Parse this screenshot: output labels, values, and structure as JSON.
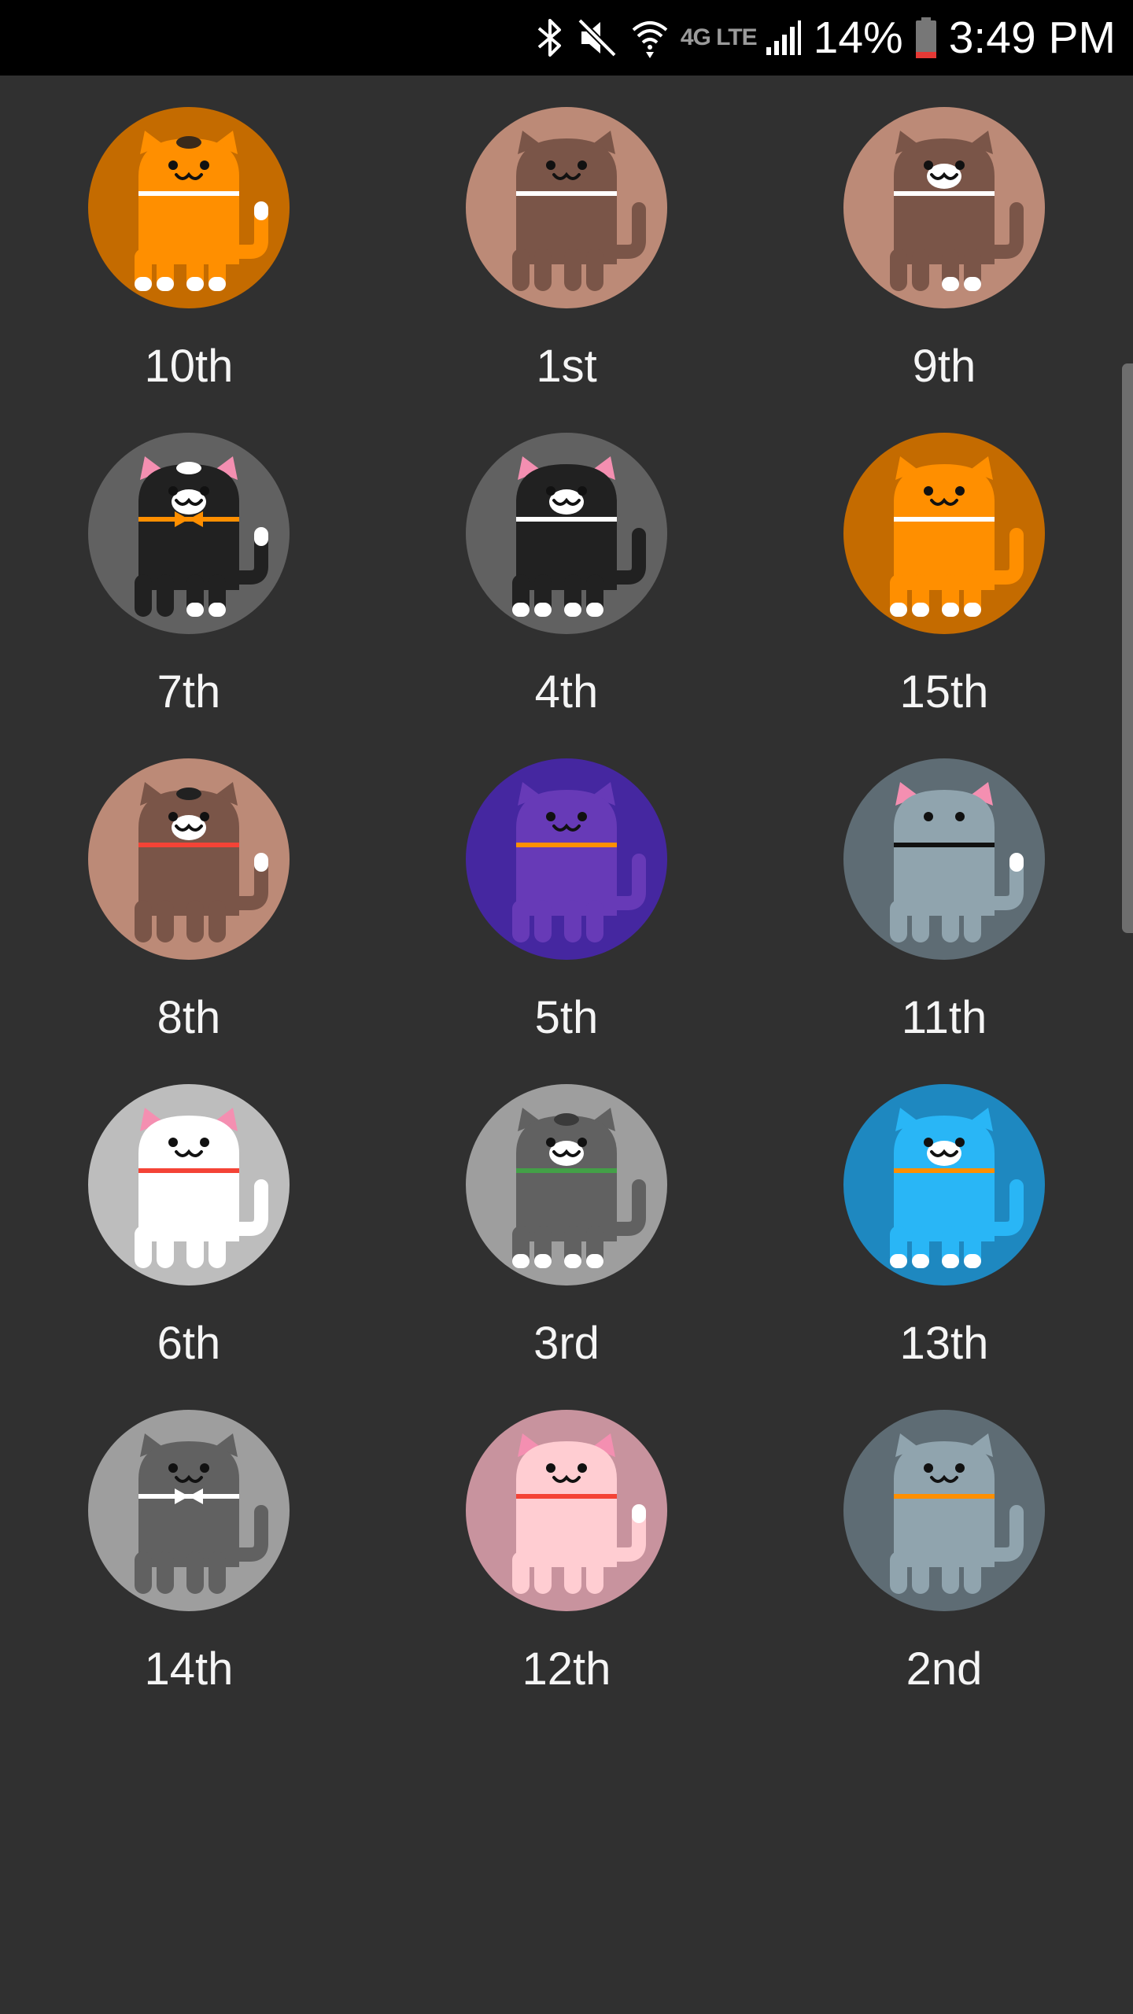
{
  "status_bar": {
    "battery_percent": "14%",
    "time": "3:49 PM",
    "network_type": "4G LTE",
    "icons": [
      "bluetooth-icon",
      "mute-icon",
      "wifi-icon",
      "lte-icon",
      "signal-icon",
      "battery-icon"
    ]
  },
  "cats": [
    {
      "label": "10th",
      "bg": "#c46b00",
      "body": "#ff8f00",
      "collar": "#ffffff",
      "ears": "#ff8f00",
      "spot": "#3a2a1a",
      "mouth": "dark",
      "white_feet": [
        1,
        1,
        1,
        1
      ],
      "white_tail": true,
      "bowtie": false
    },
    {
      "label": "1st",
      "bg": "#bc8a77",
      "body": "#7a5548",
      "collar": "#ffffff",
      "ears": "#7a5548",
      "spot": null,
      "mouth": "dark",
      "white_feet": [
        0,
        0,
        0,
        0
      ],
      "white_tail": false,
      "bowtie": false
    },
    {
      "label": "9th",
      "bg": "#bc8a77",
      "body": "#7a5548",
      "collar": "#ffffff",
      "ears": "#7a5548",
      "spot": null,
      "mouth": "white",
      "white_feet": [
        0,
        0,
        1,
        1
      ],
      "white_tail": false,
      "bowtie": false
    },
    {
      "label": "7th",
      "bg": "#616161",
      "body": "#212121",
      "collar": "#ff8f00",
      "ears": "#f48fb1",
      "spot": "#ffffff",
      "mouth": "white",
      "white_feet": [
        0,
        0,
        1,
        1
      ],
      "white_tail": true,
      "bowtie": true
    },
    {
      "label": "4th",
      "bg": "#616161",
      "body": "#212121",
      "collar": "#ffffff",
      "ears": "#f48fb1",
      "spot": null,
      "mouth": "white",
      "white_feet": [
        1,
        1,
        1,
        1
      ],
      "white_tail": false,
      "bowtie": false
    },
    {
      "label": "15th",
      "bg": "#c46b00",
      "body": "#ff8f00",
      "collar": "#ffffff",
      "ears": "#ff8f00",
      "spot": null,
      "mouth": "dark",
      "white_feet": [
        1,
        1,
        1,
        1
      ],
      "white_tail": false,
      "bowtie": false
    },
    {
      "label": "8th",
      "bg": "#bc8a77",
      "body": "#7a5548",
      "collar": "#f44336",
      "ears": "#7a5548",
      "spot": "#212121",
      "mouth": "white",
      "white_feet": [
        0,
        0,
        0,
        0
      ],
      "white_tail": true,
      "bowtie": false
    },
    {
      "label": "5th",
      "bg": "#4527a0",
      "body": "#673ab7",
      "collar": "#ff8f00",
      "ears": "#673ab7",
      "spot": null,
      "mouth": "dark",
      "white_feet": [
        0,
        0,
        0,
        0
      ],
      "white_tail": false,
      "bowtie": false
    },
    {
      "label": "11th",
      "bg": "#5e6c74",
      "body": "#90a4ae",
      "collar": "#111111",
      "ears": "#f48fb1",
      "spot": null,
      "mouth": "none",
      "white_feet": [
        0,
        0,
        0,
        0
      ],
      "white_tail": true,
      "bowtie": false
    },
    {
      "label": "6th",
      "bg": "#bdbdbd",
      "body": "#ffffff",
      "collar": "#f44336",
      "ears": "#f48fb1",
      "spot": null,
      "mouth": "dark",
      "white_feet": [
        0,
        0,
        0,
        0
      ],
      "white_tail": false,
      "bowtie": false
    },
    {
      "label": "3rd",
      "bg": "#9e9e9e",
      "body": "#616161",
      "collar": "#43a047",
      "ears": "#616161",
      "spot": "#3a3a3a",
      "mouth": "white",
      "white_feet": [
        1,
        1,
        1,
        1
      ],
      "white_tail": false,
      "bowtie": false
    },
    {
      "label": "13th",
      "bg": "#1e88c0",
      "body": "#29b6f6",
      "collar": "#ff8f00",
      "ears": "#29b6f6",
      "spot": null,
      "mouth": "white",
      "white_feet": [
        1,
        1,
        1,
        1
      ],
      "white_tail": false,
      "bowtie": false
    },
    {
      "label": "14th",
      "bg": "#9e9e9e",
      "body": "#616161",
      "collar": "#ffffff",
      "ears": "#616161",
      "spot": null,
      "mouth": "dark",
      "white_feet": [
        0,
        0,
        0,
        0
      ],
      "white_tail": false,
      "bowtie": true
    },
    {
      "label": "12th",
      "bg": "#c8939e",
      "body": "#ffcdd2",
      "collar": "#f44336",
      "ears": "#f48fb1",
      "spot": null,
      "mouth": "dark",
      "white_feet": [
        0,
        0,
        0,
        0
      ],
      "white_tail": true,
      "bowtie": false
    },
    {
      "label": "2nd",
      "bg": "#5e6c74",
      "body": "#90a4ae",
      "collar": "#ff8f00",
      "ears": "#90a4ae",
      "spot": null,
      "mouth": "dark",
      "white_feet": [
        0,
        0,
        0,
        0
      ],
      "white_tail": false,
      "bowtie": false
    }
  ]
}
